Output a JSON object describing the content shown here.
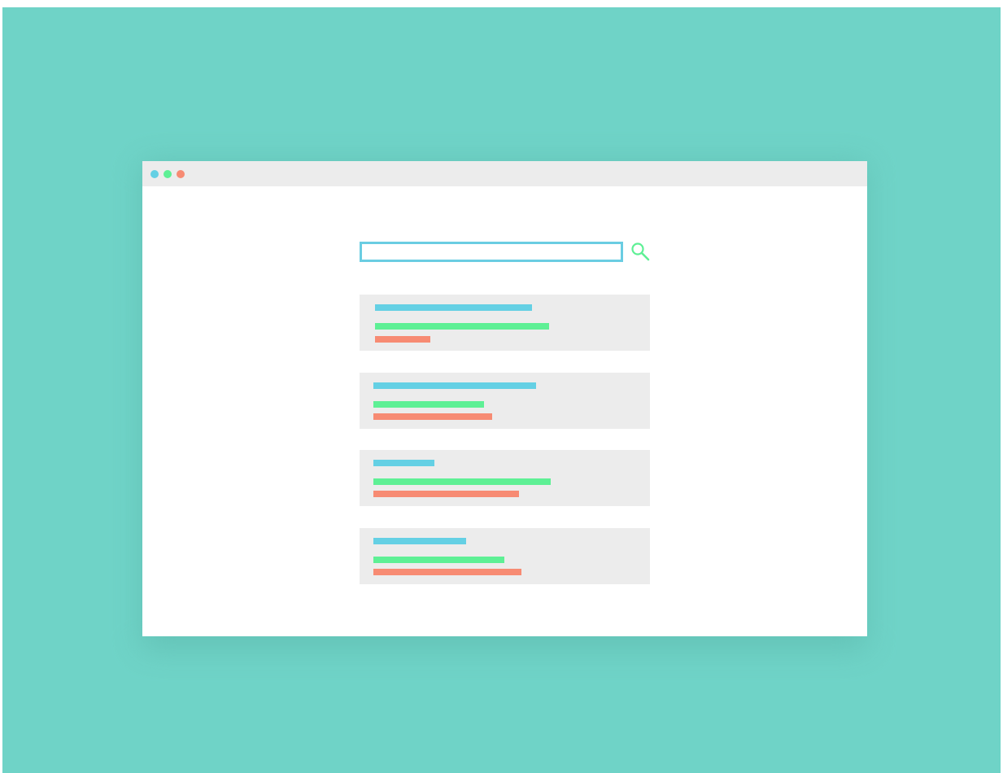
{
  "colors": {
    "background": "#6fd3c7",
    "window": "#ffffff",
    "titlebar": "#ececec",
    "blue": "#64d0e4",
    "green": "#5ef095",
    "red": "#f78b73"
  },
  "window_controls": [
    {
      "name": "blue-dot",
      "color": "#64d0e4"
    },
    {
      "name": "green-dot",
      "color": "#5ef095"
    },
    {
      "name": "red-dot",
      "color": "#f78b73"
    }
  ],
  "search": {
    "value": "",
    "placeholder": "",
    "icon": "magnifier-icon",
    "icon_color": "#5ef095"
  },
  "results": [
    {
      "title_fill": 0.54,
      "line1_fill": 0.6,
      "line2_fill": 0.19
    },
    {
      "title_fill": 0.56,
      "line1_fill": 0.38,
      "line2_fill": 0.41
    },
    {
      "title_fill": 0.21,
      "line1_fill": 0.61,
      "line2_fill": 0.5
    },
    {
      "title_fill": 0.32,
      "line1_fill": 0.45,
      "line2_fill": 0.51
    }
  ]
}
